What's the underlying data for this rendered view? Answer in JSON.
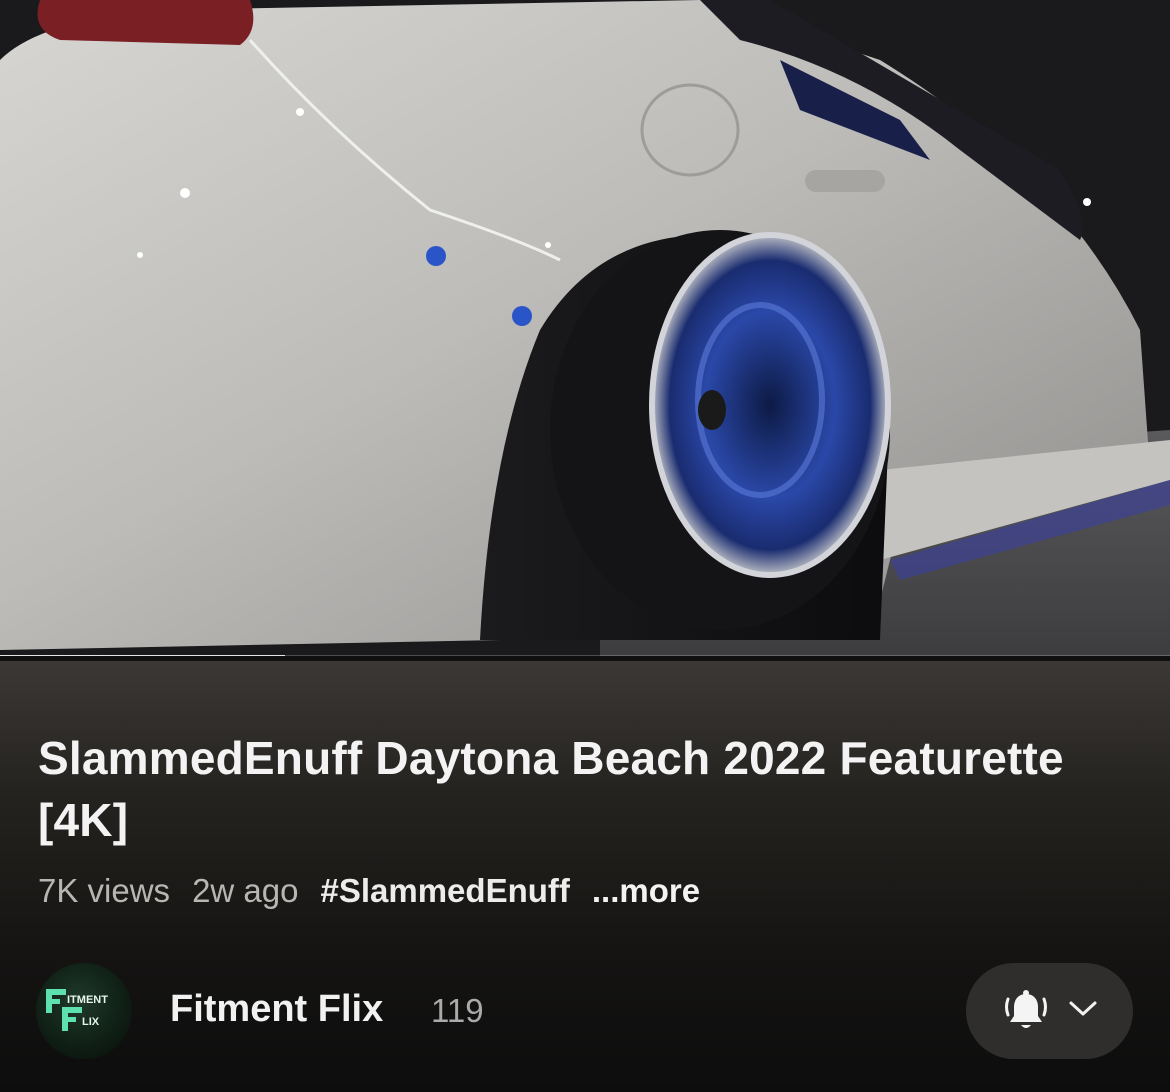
{
  "player": {
    "thumbnail_description": "",
    "progress_fraction": 0.244
  },
  "video": {
    "title": "SlammedEnuff Daytona Beach 2022 Featurette [4K]",
    "views": "7K views",
    "age": "2w ago",
    "hashtag": "#SlammedEnuff",
    "more_label": "...more"
  },
  "channel": {
    "name": "Fitment Flix",
    "subscriber_count": "119",
    "avatar_text_top": "ITMENT",
    "avatar_text_bottom": "LIX",
    "avatar_icon": "fitment-flix-logo"
  },
  "subscribe": {
    "bell_icon": "bell-ringing-icon",
    "chevron_icon": "chevron-down-icon"
  },
  "colors": {
    "background": "#0f0f0f",
    "pill": "#2f2e2c",
    "logo_accent": "#5fe0b0",
    "wheel_accent": "#2f4fb5"
  }
}
